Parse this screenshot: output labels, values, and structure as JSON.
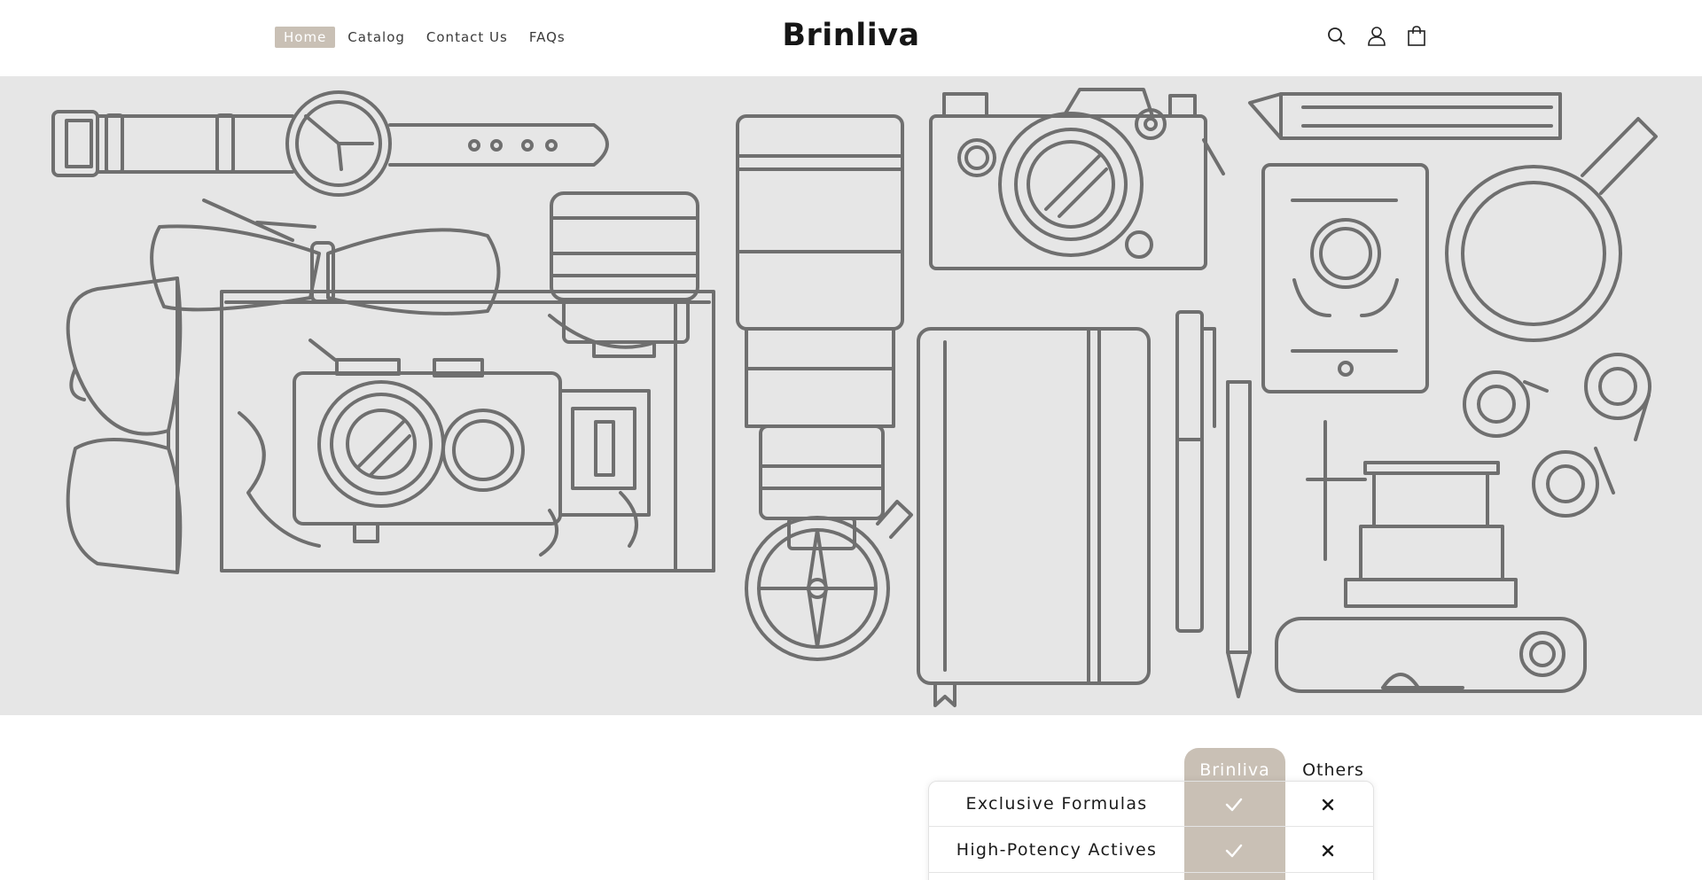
{
  "header": {
    "nav": [
      {
        "label": "Home",
        "active": true
      },
      {
        "label": "Catalog",
        "active": false
      },
      {
        "label": "Contact Us",
        "active": false
      },
      {
        "label": "FAQs",
        "active": false
      }
    ],
    "brand": "Brinliva",
    "icons": [
      "search-icon",
      "account-icon",
      "cart-icon"
    ]
  },
  "hero": {
    "background": "#e6e6e6",
    "illustration": "outline drawing of travel items: watch, bow tie, lenses, cameras, pencil, passport, magnifier, sunglasses, map, compass, notebook, pen, tape rolls"
  },
  "comparison": {
    "columns": [
      "Brinliva",
      "Others"
    ],
    "rows": [
      {
        "feature": "Exclusive Formulas",
        "brinliva": "check",
        "others": "cross"
      },
      {
        "feature": "High-Potency Actives",
        "brinliva": "check",
        "others": "cross"
      }
    ]
  },
  "colors": {
    "accent": "#c9c0b5",
    "line": "#6f6f6f",
    "text": "#1b1b1b"
  }
}
